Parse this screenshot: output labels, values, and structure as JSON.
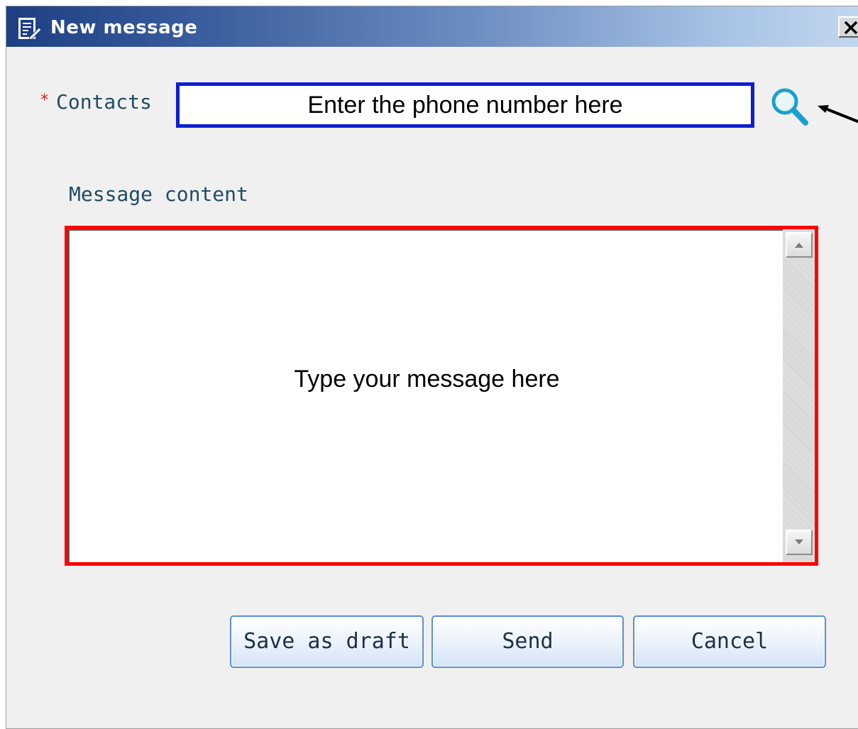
{
  "window": {
    "title": "New message",
    "title_icon": "compose-document-icon",
    "close_icon": "close-icon",
    "titlebar_color_start": "#1d3f83",
    "titlebar_color_end": "#c2d6ef"
  },
  "form": {
    "required_marker": "*",
    "contacts_label": "Contacts",
    "contacts_placeholder": "Enter the phone number here",
    "contacts_value": "",
    "search_icon": "search-icon",
    "message_label": "Message content",
    "message_placeholder": "Type your message here",
    "message_value": "",
    "contacts_highlight_color": "#0d1fcf",
    "message_highlight_color": "#ff0000"
  },
  "buttons": {
    "save_draft": "Save as draft",
    "send": "Send",
    "cancel": "Cancel"
  }
}
